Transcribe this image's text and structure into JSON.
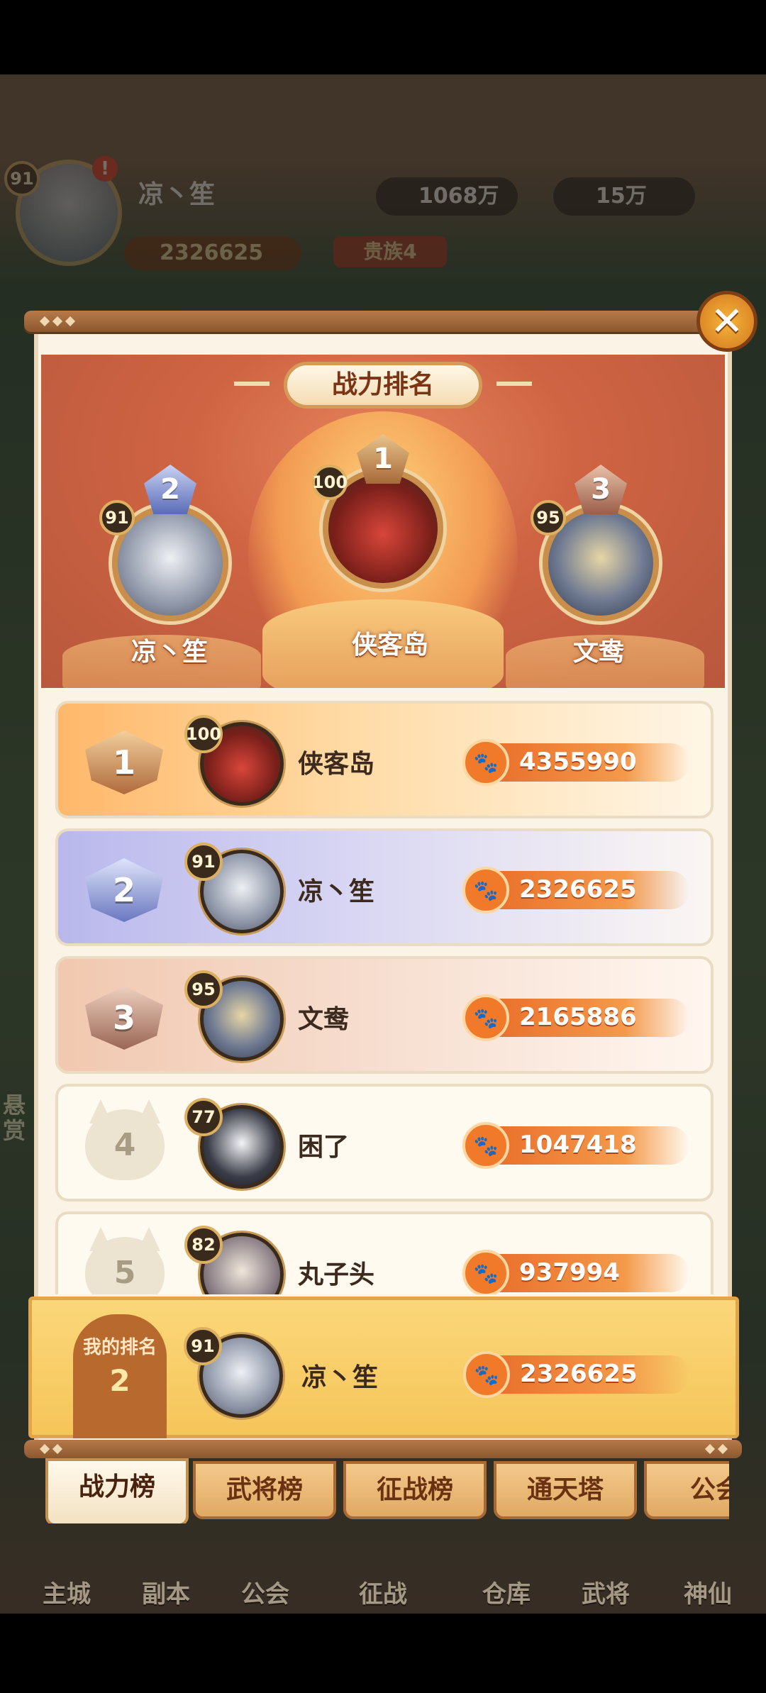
{
  "hud": {
    "level": "91",
    "alert": "!",
    "player_name": "凉丶笙",
    "power": "2326625",
    "noble": "贵族4",
    "currency1": "1068万",
    "currency2": "15万"
  },
  "side_text": "悬赏",
  "close_label": "✕",
  "title": "战力排名",
  "podium": [
    {
      "rank": "1",
      "level": "100",
      "name": "侠客岛"
    },
    {
      "rank": "2",
      "level": "91",
      "name": "凉丶笙"
    },
    {
      "rank": "3",
      "level": "95",
      "name": "文鸯"
    }
  ],
  "rows": [
    {
      "rank": "1",
      "level": "100",
      "name": "侠客岛",
      "power": "4355990"
    },
    {
      "rank": "2",
      "level": "91",
      "name": "凉丶笙",
      "power": "2326625"
    },
    {
      "rank": "3",
      "level": "95",
      "name": "文鸯",
      "power": "2165886"
    },
    {
      "rank": "4",
      "level": "77",
      "name": "困了",
      "power": "1047418"
    },
    {
      "rank": "5",
      "level": "82",
      "name": "丸子头",
      "power": "937994"
    }
  ],
  "my_rank": {
    "label": "我的排名",
    "rank": "2",
    "level": "91",
    "name": "凉丶笙",
    "power": "2326625"
  },
  "tabs": [
    "战力榜",
    "武将榜",
    "征战榜",
    "通天塔",
    "公会"
  ],
  "bottom_nav": [
    "主城",
    "副本",
    "公会",
    "征战",
    "仓库",
    "武将",
    "神仙"
  ],
  "colors": {
    "accent": "#e86a26",
    "panel": "#fbf4e6",
    "rail": "#8d5830"
  }
}
